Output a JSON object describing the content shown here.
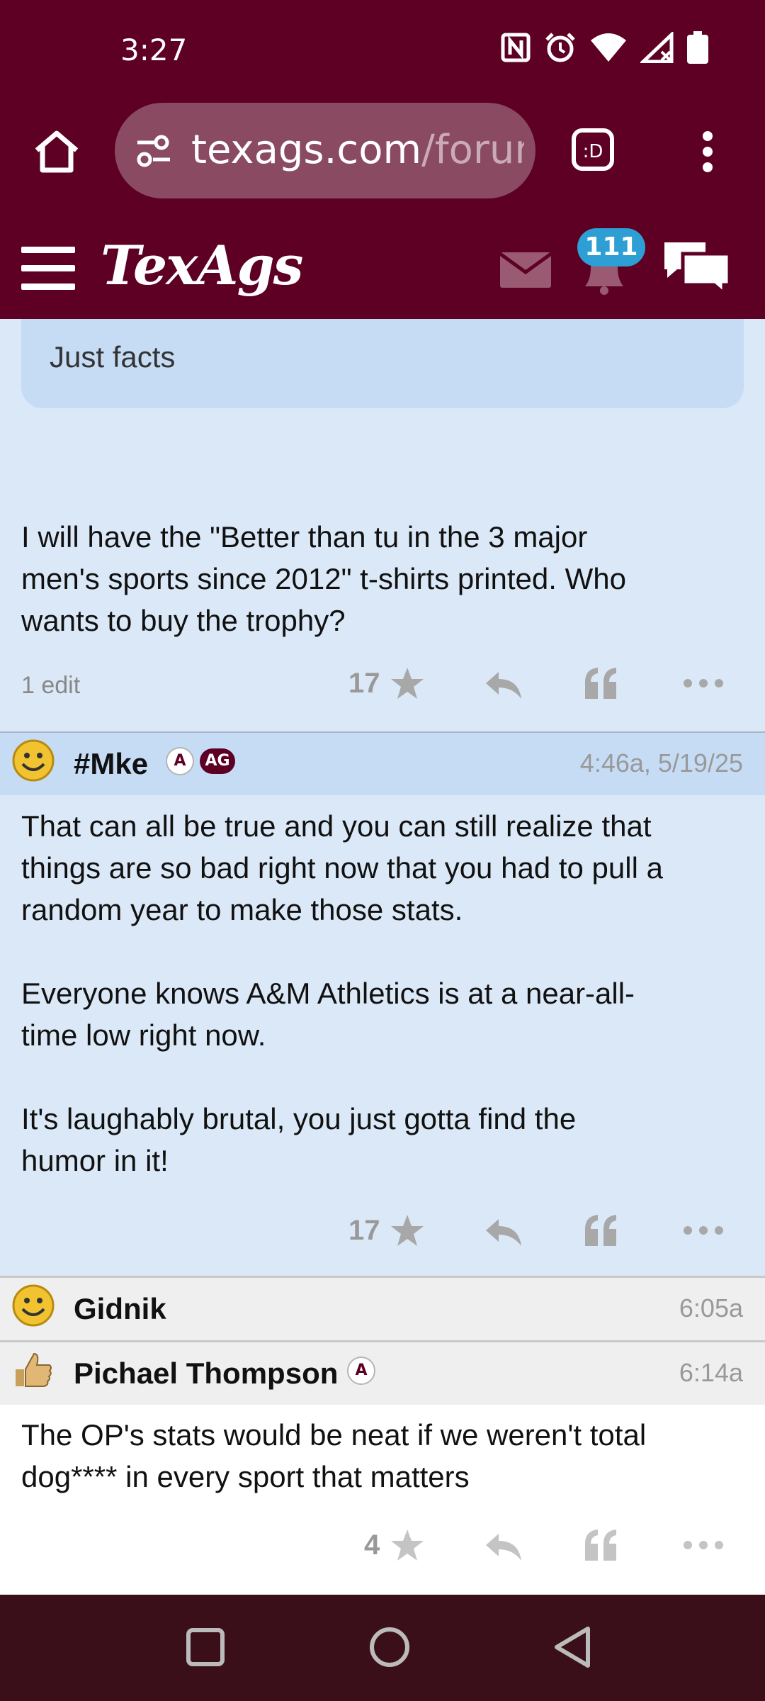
{
  "status_bar": {
    "time": "3:27"
  },
  "browser": {
    "url_host": "texags.com",
    "url_path": "/forum"
  },
  "site": {
    "logo": "TexAgs",
    "notification_count": "111"
  },
  "posts": [
    {
      "quote": "Just facts",
      "body": "I will have the \"Better than tu in the 3 major\nmen's sports since 2012\" t-shirts printed. Who\nwants to buy the trophy?",
      "edit_label": "1 edit",
      "stars": "17"
    },
    {
      "username": "#Mke",
      "badge_a": "A",
      "badge_ag": "AG",
      "time": "4:46a, 5/19/25",
      "body": "That can all be true and you can still realize that\nthings are so bad right now that you had to pull a\nrandom year to make those stats.\n\nEveryone knows A&M Athletics is at a near-all-\ntime low right now.\n\nIt's laughably brutal, you just gotta find the\nhumor in it!",
      "stars": "17"
    },
    {
      "username": "Gidnik",
      "time": "6:05a"
    },
    {
      "username": "Pichael Thompson",
      "badge_a": "A",
      "time": "6:14a",
      "body": "The OP's stats would be neat if we weren't total\ndog**** in every sport that matters",
      "stars": "4"
    }
  ],
  "colors": {
    "maroon": "#5e0024",
    "post_bg": "#dbe8f7",
    "accent_blue": "#2e9fd4"
  }
}
